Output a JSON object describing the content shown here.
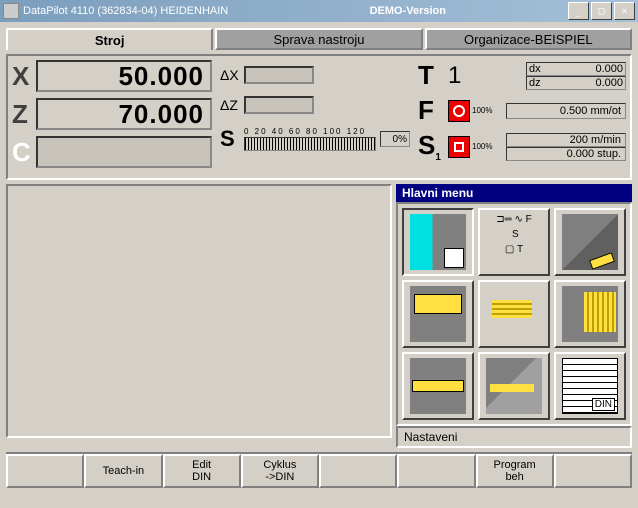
{
  "window": {
    "title": "DataPilot 4110 (362834-04) HEIDENHAIN",
    "demo": "DEMO-Version"
  },
  "tabs": {
    "machine": "Stroj",
    "tool_admin": "Sprava nastroju",
    "organization": "Organizace-BEISPIEL"
  },
  "dro": {
    "x_label": "X",
    "x_val": "50.000",
    "z_label": "Z",
    "z_val": "70.000",
    "c_label": "C",
    "dx_label": "ΔX",
    "dz_label": "ΔZ",
    "s_label": "S",
    "scale_ticks": "0  20  40  60  80 100 120",
    "s_pct": "0%"
  },
  "status": {
    "t_label": "T",
    "t_val": "1",
    "dx_label": "dx",
    "dx_val": "0.000",
    "dz_label": "dz",
    "dz_val": "0.000",
    "f_label": "F",
    "f_pct": "100%",
    "f_val": "0.500 mm/ot",
    "s_label": "S",
    "s_sub": "1",
    "s_pct": "100%",
    "s_val1": "200 m/min",
    "s_val2": "0.000 stup."
  },
  "menu": {
    "title": "Hlavni menu",
    "status_text": "Nastaveni",
    "items": [
      {
        "name": "workpiece-setup"
      },
      {
        "name": "tool-fst",
        "labels": [
          "F",
          "S",
          "T"
        ]
      },
      {
        "name": "single-cut"
      },
      {
        "name": "roughing"
      },
      {
        "name": "grooving"
      },
      {
        "name": "threading"
      },
      {
        "name": "drilling"
      },
      {
        "name": "milling"
      },
      {
        "name": "din-program"
      }
    ]
  },
  "softkeys": {
    "k1": "",
    "k2": "Teach-in",
    "k3": "Edit\nDIN",
    "k4": "Cyklus\n->DIN",
    "k5": "",
    "k6": "",
    "k7": "Program\nbeh",
    "k8": ""
  }
}
